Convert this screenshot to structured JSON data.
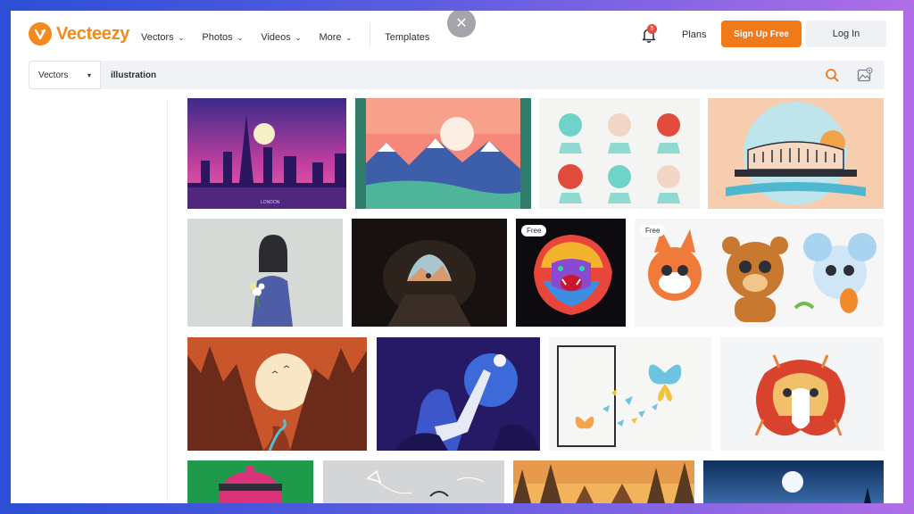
{
  "header": {
    "brand": "Vecteezy",
    "nav": [
      {
        "label": "Vectors",
        "dropdown": true
      },
      {
        "label": "Photos",
        "dropdown": true
      },
      {
        "label": "Videos",
        "dropdown": true
      },
      {
        "label": "More",
        "dropdown": true
      }
    ],
    "templates_label": "Templates",
    "notification_count": "5",
    "plans_label": "Plans",
    "signup_label": "Sign Up Free",
    "login_label": "Log In",
    "close_symbol": "✕"
  },
  "search": {
    "type_label": "Vectors",
    "query": "illustration",
    "icons": [
      "search-icon",
      "image-search-icon"
    ]
  },
  "results": [
    {
      "name": "city-skyline",
      "caption": "LONDON",
      "badge": ""
    },
    {
      "name": "mountain-landscape",
      "badge": ""
    },
    {
      "name": "faces-set",
      "badge": ""
    },
    {
      "name": "colosseum",
      "badge": ""
    },
    {
      "name": "girl-with-flowers",
      "badge": ""
    },
    {
      "name": "cave",
      "badge": ""
    },
    {
      "name": "colorful-lion",
      "badge": "Free"
    },
    {
      "name": "cute-animals",
      "badge": "Free"
    },
    {
      "name": "canyon-moon",
      "badge": ""
    },
    {
      "name": "astronaut-girl",
      "badge": ""
    },
    {
      "name": "butterflies",
      "badge": ""
    },
    {
      "name": "tribal-elephant",
      "badge": ""
    },
    {
      "name": "green-hat",
      "badge": ""
    },
    {
      "name": "grey-sketch",
      "badge": ""
    },
    {
      "name": "sunset-forest",
      "badge": ""
    },
    {
      "name": "night-moon",
      "badge": ""
    }
  ],
  "colors": {
    "brand_orange": "#f28a1f",
    "signup_orange": "#f07a1a",
    "badge_red": "#e84a3c"
  }
}
